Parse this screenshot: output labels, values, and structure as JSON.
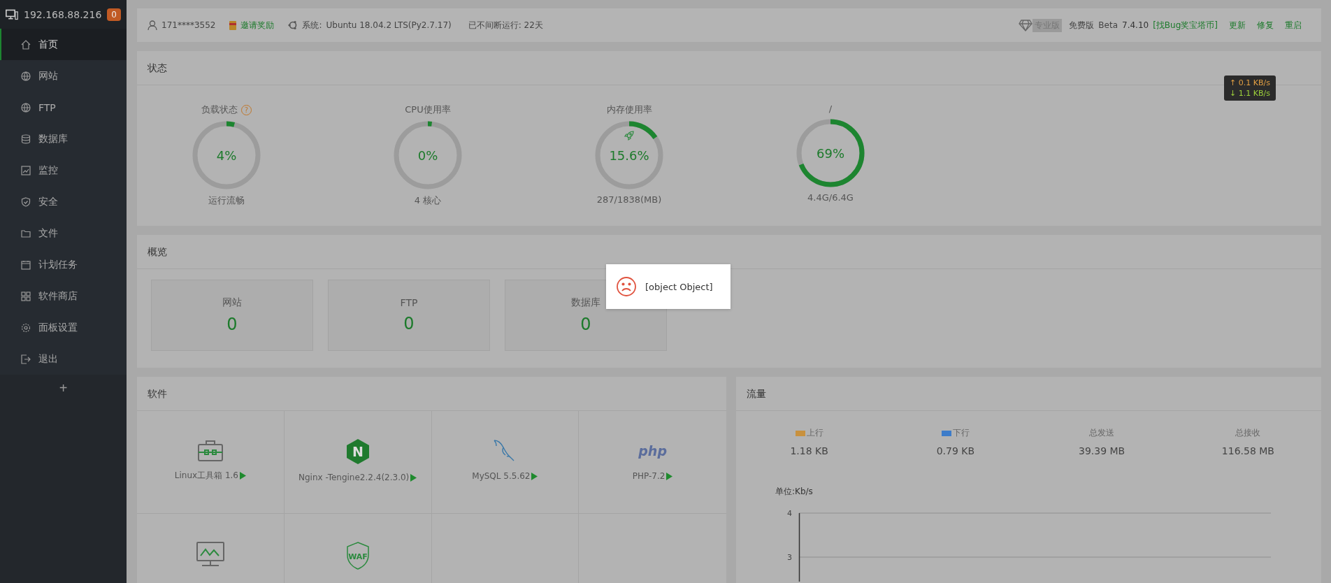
{
  "sidebar": {
    "host": "192.168.88.216",
    "badge": "0",
    "items": [
      {
        "label": "首页",
        "selected": true
      },
      {
        "label": "网站",
        "selected": false
      },
      {
        "label": "FTP",
        "selected": false
      },
      {
        "label": "数据库",
        "selected": false
      },
      {
        "label": "监控",
        "selected": false
      },
      {
        "label": "安全",
        "selected": false
      },
      {
        "label": "文件",
        "selected": false
      },
      {
        "label": "计划任务",
        "selected": false
      },
      {
        "label": "软件商店",
        "selected": false
      },
      {
        "label": "面板设置",
        "selected": false
      },
      {
        "label": "退出",
        "selected": false
      }
    ],
    "add": "+"
  },
  "topbar": {
    "user": "171****3552",
    "invite": "邀请奖励",
    "system_label": "系统:",
    "system": "Ubuntu 18.04.2 LTS(Py2.7.17)",
    "uptime": "已不间断运行: 22天",
    "pro_badge": "专业版",
    "edition": "免费版",
    "beta": "Beta",
    "version": "7.4.10",
    "bug_link": "[找Bug奖宝塔币]",
    "actions": [
      "更新",
      "修复",
      "重启"
    ]
  },
  "speed": {
    "up": "↑ 0.1 KB/s",
    "down": "↓ 1.1 KB/s"
  },
  "status": {
    "title": "状态",
    "gauges": [
      {
        "kind": "load",
        "title": "负载状态",
        "help": "?",
        "value": "4%",
        "level": 0.04,
        "caption": "运行流畅"
      },
      {
        "kind": "cpu",
        "title": "CPU使用率",
        "value": "0%",
        "level": 0,
        "caption": "4 核心"
      },
      {
        "kind": "memory",
        "title": "内存使用率",
        "value": "15.6%",
        "level": 0.156,
        "caption": "287/1838(MB)"
      },
      {
        "kind": "disk",
        "title": "/",
        "value": "69%",
        "level": 0.69,
        "caption": "4.4G/6.4G"
      }
    ]
  },
  "overview": {
    "title": "概览",
    "cards": [
      {
        "label": "网站",
        "value": "0"
      },
      {
        "label": "FTP",
        "value": "0"
      },
      {
        "label": "数据库",
        "value": "0"
      }
    ]
  },
  "software": {
    "title": "软件",
    "items": [
      {
        "kind": "toolbox",
        "name": "Linux工具箱 1.6"
      },
      {
        "kind": "nginx",
        "logo_text": "N",
        "name": "Nginx -Tengine2.2.4(2.3.0)"
      },
      {
        "kind": "mysql",
        "name": "MySQL 5.5.62"
      },
      {
        "kind": "php",
        "logo_text": "php",
        "name": "PHP-7.2"
      },
      {
        "kind": "monitor"
      },
      {
        "kind": "waf",
        "logo_text": "WAF"
      },
      {
        "kind": "empty"
      },
      {
        "kind": "empty"
      }
    ]
  },
  "traffic": {
    "title": "流量",
    "stats": [
      {
        "label": "上行",
        "value": "1.18 KB",
        "color": "#c8913e"
      },
      {
        "label": "下行",
        "value": "0.79 KB",
        "color": "#3d7cc9"
      },
      {
        "label": "总发送",
        "value": "39.39 MB"
      },
      {
        "label": "总接收",
        "value": "116.58 MB"
      }
    ],
    "chart": {
      "unit": "单位:Kb/s",
      "axis_labels": [
        "4",
        "3"
      ]
    }
  },
  "toast": {
    "message": "[object Object]"
  }
}
